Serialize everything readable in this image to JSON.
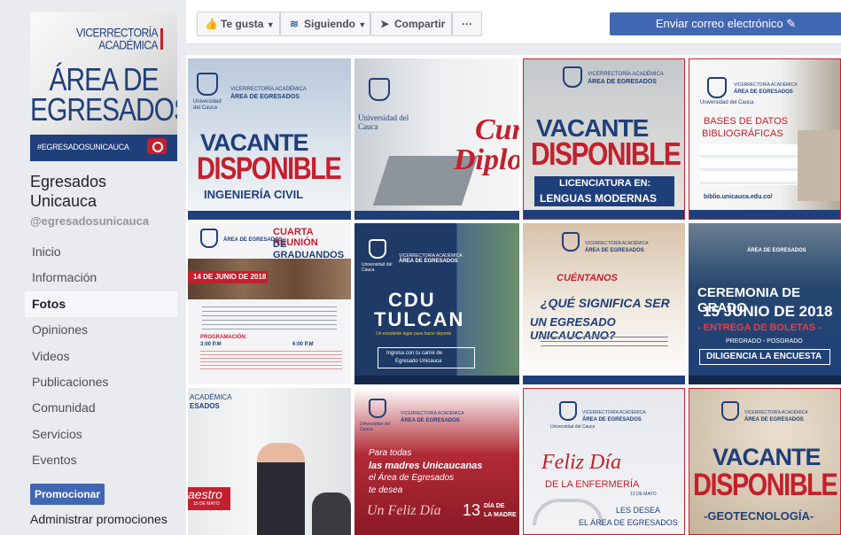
{
  "cover": {
    "top_line1": "VICERRECTORÍA",
    "top_line2": "ACADÉMICA",
    "big1": "ÁREA DE",
    "big2": "EGRESADOS",
    "hashtag": "#EGRESADOSUNICAUCA"
  },
  "page": {
    "name": "Egresados Unicauca",
    "handle": "@egresadosunicauca"
  },
  "nav": [
    "Inicio",
    "Información",
    "Fotos",
    "Opiniones",
    "Videos",
    "Publicaciones",
    "Comunidad",
    "Servicios",
    "Eventos"
  ],
  "nav_active": "Fotos",
  "promote": {
    "button": "Promocionar",
    "manage": "Administrar promociones"
  },
  "actions": {
    "like": "Te gusta",
    "follow": "Siguiendo",
    "share": "Compartir",
    "more": "···",
    "email": "Enviar correo electrónico"
  },
  "photos": [
    {
      "l1": "VICERRECTORÍA ACADÉMICA",
      "l2": "ÁREA DE EGRESADOS",
      "big1": "VACANTE",
      "big2": "DISPONIBLE",
      "sub": "INGENIERÍA CIVIL",
      "org": "Universidad del Cauca"
    },
    {
      "org": "Universidad del Cauca",
      "big1": "Cur",
      "big2": "Diplo"
    },
    {
      "l1": "VICERRECTORÍA ACADÉMICA",
      "l2": "ÁREA DE EGRESADOS",
      "big1": "VACANTE",
      "big2": "DISPONIBLE",
      "sub1": "LICENCIATURA EN:",
      "sub2": "LENGUAS MODERNAS"
    },
    {
      "l1": "VICERRECTORÍA ACADÉMICA",
      "l2": "ÁREA DE EGRESADOS",
      "big1": "BASES DE DATOS",
      "big2": "BIBLIOGRÁFICAS",
      "foot": "biblio.unicauca.edu.co/",
      "org": "Universidad del Cauca"
    },
    {
      "l2": "ÁREA DE EGRESADOS",
      "big1": "CUARTA REUNIÓN",
      "big2": "DE GRADUANDOS",
      "date": "14 DE JUNIO DE 2018",
      "prog": "PROGRAMACIÓN:",
      "t1": "3:00 P.M",
      "t2": "6:00 P.M"
    },
    {
      "l1": "VICERRECTORÍA ACADÉMICA",
      "l2": "ÁREA DE EGRESADOS",
      "big1": "CDU",
      "big2": "TULCAN",
      "sub": "Un excelente lugar para hacer deporte",
      "foot1": "Ingresa con tu carné de",
      "foot2": "Egresado Unicauca",
      "org": "Universidad del Cauca"
    },
    {
      "l1": "VICERRECTORÍA ACADÉMICA",
      "l2": "ÁREA DE EGRESADOS",
      "big0": "CUÉNTANOS",
      "big1": "¿QUÉ SIGNIFICA SER",
      "big2": "UN EGRESADO UNICAUCANO?"
    },
    {
      "l2": "ÁREA DE EGRESADOS",
      "big1": "CEREMONIA DE GRADO",
      "big2": "15 JUNIO DE 2018",
      "sub": "- ENTREGA DE BOLETAS -",
      "mid": "PREGRADO - POSGRADO",
      "foot": "DILIGENCIA LA ENCUESTA"
    },
    {
      "l1": "ACADÉMICA",
      "l2": "ESADOS",
      "big1": "aestro",
      "sub": "15 DE MAYO"
    },
    {
      "l1": "VICERRECTORÍA ACADÉMICA",
      "l2": "ÁREA DE EGRESADOS",
      "big0": "Para todas",
      "big1": "las madres Unicaucanas",
      "big2": "el Área de Egresados",
      "big3": "te desea",
      "big4": "Un Feliz Día",
      "side1": "13",
      "side2": "DÍA DE",
      "side3": "LA MADRE",
      "org": "Universidad del Cauca"
    },
    {
      "l1": "VICERRECTORÍA ACADÉMICA",
      "l2": "ÁREA DE EGRESADOS",
      "big1": "Feliz Día",
      "big2": "DE LA ENFERMERÍA",
      "date": "12 DE MAYO",
      "foot1": "LES DESEA",
      "foot2": "EL ÁREA DE EGRESADOS",
      "org": "Universidad del Cauca"
    },
    {
      "l1": "VICERRECTORÍA ACADÉMICA",
      "l2": "ÁREA DE EGRESADOS",
      "big1": "VACANTE",
      "big2": "DISPONIBLE",
      "sub": "-GEOTECNOLOGÍA-"
    }
  ]
}
